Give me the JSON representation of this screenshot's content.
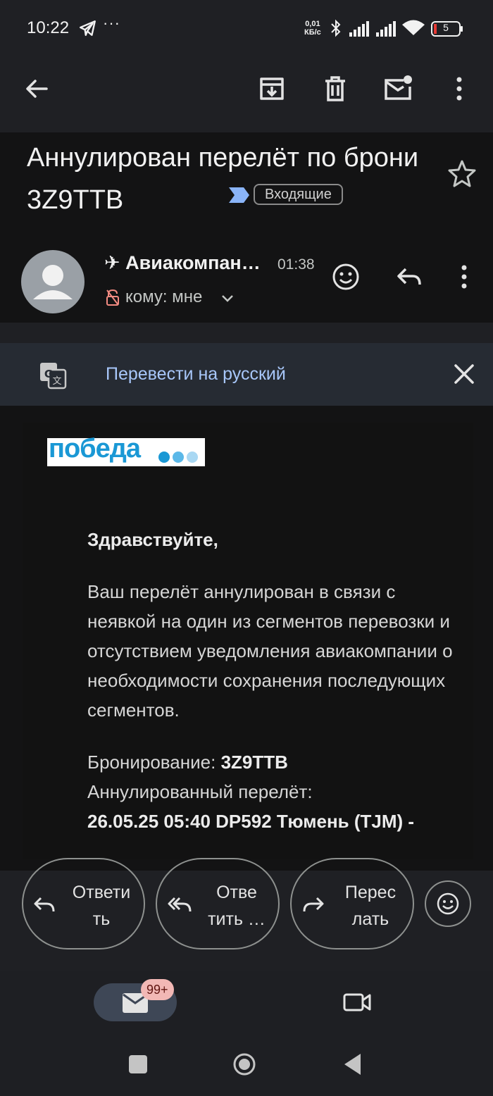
{
  "status_bar": {
    "time": "10:22",
    "speed_value": "0,01",
    "speed_unit": "КБ/с",
    "battery": "5",
    "more": "···"
  },
  "toolbar": {
    "back": "back-icon",
    "archive": "archive-icon",
    "delete": "delete-icon",
    "mark_unread": "mark-unread-icon",
    "more": "more-vert-icon"
  },
  "message": {
    "subject": "Аннулирован перелёт по брони 3Z9TTB",
    "label": "Входящие",
    "sender": "✈ Авиакомпан…",
    "time": "01:38",
    "recipient": "кому: мне"
  },
  "translate_bar": {
    "label": "Перевести на русский"
  },
  "email_body": {
    "logo_text": "победа",
    "greeting": "Здравствуйте,",
    "paragraph": "Ваш перелёт аннулирован в связи с неявкой на один из сегментов перевозки и отсутствием уведомления авиакомпании о необходимости сохранения последующих сегментов.",
    "booking_label": "Бронирование: ",
    "booking_code": "3Z9TTB",
    "cancelled_label": "Аннулированный перелёт:",
    "flight": "26.05.25 05:40 DP592 Тюмень (TJM) -"
  },
  "actions": {
    "reply_line1": "Ответи",
    "reply_line2": "ть",
    "reply_all_line1": "Отве",
    "reply_all_line2": "тить …",
    "forward_line1": "Перес",
    "forward_line2": "лать"
  },
  "bottom_nav": {
    "badge": "99+"
  },
  "colors": {
    "accent_link": "#a8c7fa",
    "brand": "#1a98d5",
    "badge_bg": "#f2b8b5"
  }
}
